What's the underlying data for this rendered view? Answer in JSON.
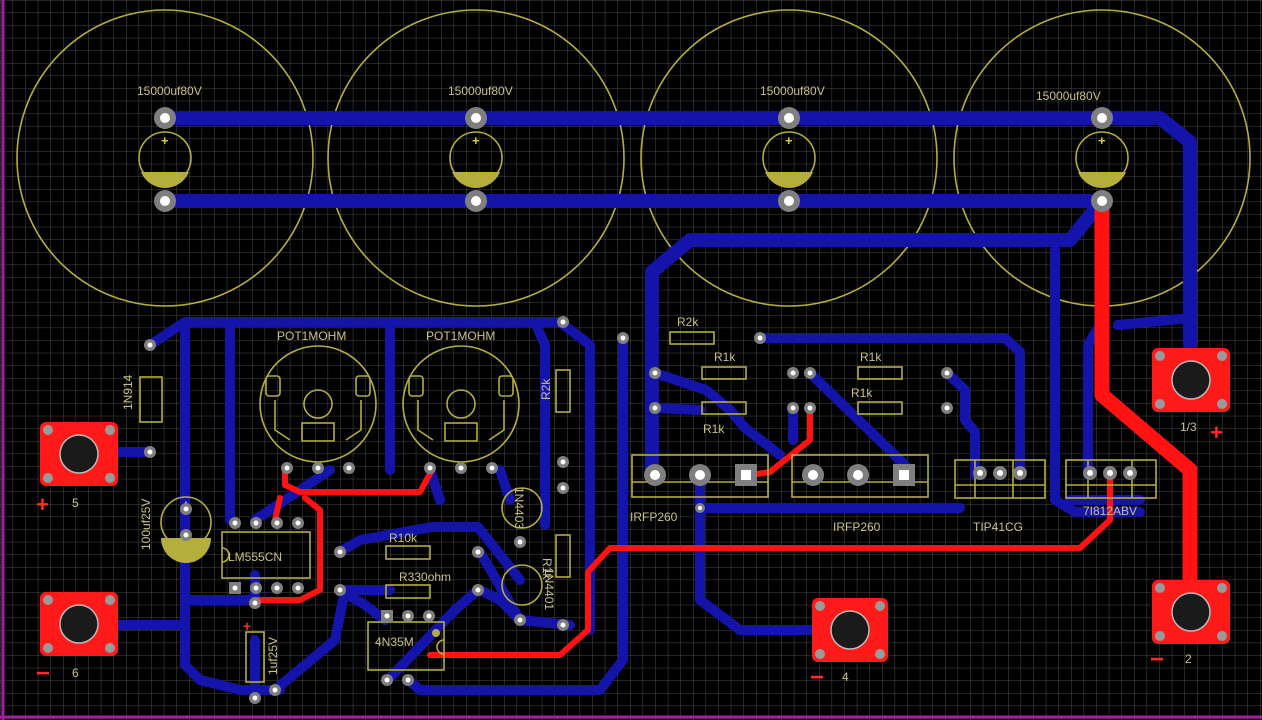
{
  "colors": {
    "background": "#000000",
    "grid": "#4a4a4a",
    "board_edge": "#a020a0",
    "silkscreen": "#b5ad3c",
    "top_copper": "#ff1212",
    "bottom_copper": "#1414aa",
    "pad": "#7f7f7f"
  },
  "capacitors": [
    {
      "label": "15000uf80V"
    },
    {
      "label": "15000uf80V"
    },
    {
      "label": "15000uf80V"
    },
    {
      "label": "15000uf80V"
    }
  ],
  "components": {
    "diode_1n914": "1N914",
    "cap_100uf": "100uf25V",
    "cap_1uf": "1uf25V",
    "ic_555": "LM555CN",
    "opto": "4N35M",
    "pot_left": "POT1MOHM",
    "pot_right": "POT1MOHM",
    "r_2k_vert": "R2k",
    "diode_1n4403": "1N4403",
    "r_1k_vert": "R1k",
    "diode_1n4401": "1N4401",
    "r_10k": "R10k",
    "r_330": "R330ohm",
    "r_2k": "R2k",
    "r_1k_a": "R1k",
    "r_1k_b": "R1k",
    "r_1k_c": "R1k",
    "r_1k_d": "R1k",
    "mosfet_a": "IRFP260",
    "mosfet_b": "IRFP260",
    "transistor": "TIP41CG",
    "regulator": "7I812ABV"
  },
  "terminals": [
    {
      "number": "5",
      "polarity": "+"
    },
    {
      "number": "6",
      "polarity": "−"
    },
    {
      "number": "1/3",
      "polarity": "+"
    },
    {
      "number": "2",
      "polarity": "−"
    },
    {
      "number": "4",
      "polarity": "−"
    }
  ]
}
